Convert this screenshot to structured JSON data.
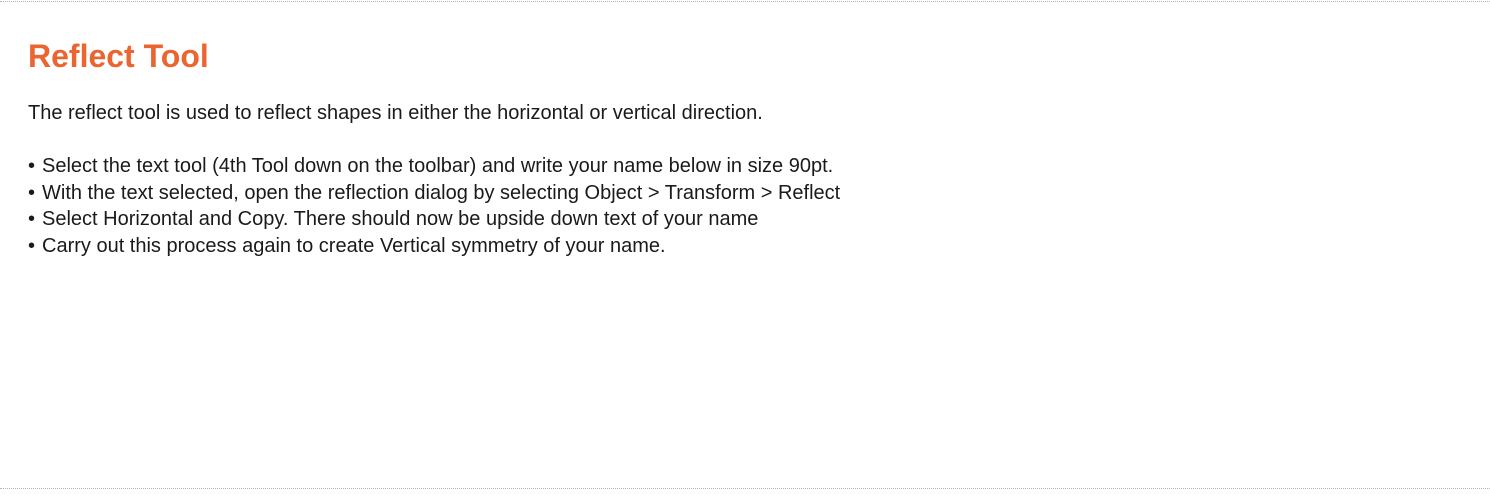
{
  "colors": {
    "title": "#EB6530",
    "body_text": "#1a1a1a",
    "divider": "#b5b5b5"
  },
  "page": {
    "title": "Reflect Tool",
    "intro": "The reflect tool is used to reflect shapes in either the horizontal or vertical direction.",
    "bullet_glyph": "•",
    "steps": [
      "Select the text tool (4th Tool down on the toolbar) and write your name below in size 90pt.",
      "With the text selected, open the reflection dialog by selecting Object > Transform > Reflect",
      "Select Horizontal and Copy. There should now be upside down text of your name",
      "Carry out this process again to create Vertical symmetry of your name."
    ]
  }
}
